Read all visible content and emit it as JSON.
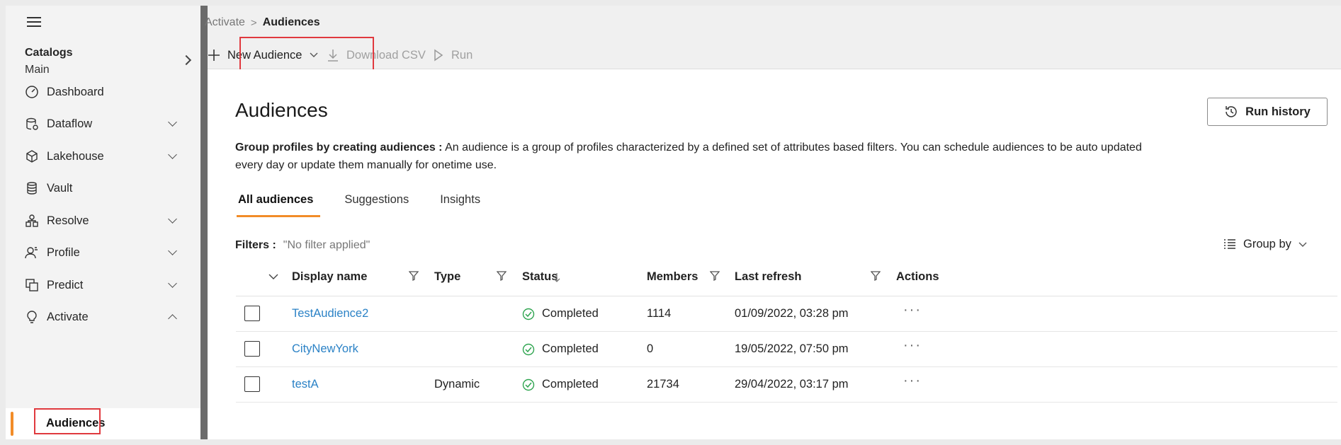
{
  "sidebar": {
    "catalogs_title": "Catalogs",
    "catalogs_value": "Main",
    "items": [
      {
        "label": "Dashboard",
        "icon": "dashboard-icon"
      },
      {
        "label": "Dataflow",
        "icon": "dataflow-icon"
      },
      {
        "label": "Lakehouse",
        "icon": "lakehouse-icon"
      },
      {
        "label": "Vault",
        "icon": "vault-icon"
      },
      {
        "label": "Resolve",
        "icon": "resolve-icon"
      },
      {
        "label": "Profile",
        "icon": "profile-icon"
      },
      {
        "label": "Predict",
        "icon": "predict-icon"
      },
      {
        "label": "Activate",
        "icon": "activate-icon"
      }
    ],
    "sub_item": "Audiences"
  },
  "breadcrumb": {
    "parent": "Activate",
    "separator": ">",
    "current": "Audiences"
  },
  "toolbar": {
    "new_audience": "New Audience",
    "download_csv": "Download CSV",
    "run": "Run"
  },
  "page": {
    "title": "Audiences",
    "run_history": "Run history",
    "desc_bold": "Group profiles by creating audiences :",
    "desc_text": " An audience is a group of profiles characterized by a defined set of attributes based filters. You can schedule audiences to be auto updated every day or update them manually for onetime use."
  },
  "tabs": [
    "All audiences",
    "Suggestions",
    "Insights"
  ],
  "filters": {
    "label": "Filters :",
    "value": "\"No filter applied\""
  },
  "group_by": "Group by",
  "table": {
    "columns": {
      "display_name": "Display name",
      "type": "Type",
      "status": "Status",
      "members": "Members",
      "last_refresh": "Last refresh",
      "actions": "Actions"
    },
    "rows": [
      {
        "name": "TestAudience2",
        "type": "",
        "status": "Completed",
        "members": "1114",
        "last_refresh": "01/09/2022, 03:28 pm"
      },
      {
        "name": "CityNewYork",
        "type": "",
        "status": "Completed",
        "members": "0",
        "last_refresh": "19/05/2022, 07:50 pm"
      },
      {
        "name": "testA",
        "type": "Dynamic",
        "status": "Completed",
        "members": "21734",
        "last_refresh": "29/04/2022, 03:17 pm"
      }
    ]
  },
  "colors": {
    "accent": "#f28c28",
    "link": "#2b82c6",
    "highlight": "#e0393e",
    "success": "#2ea44f"
  }
}
